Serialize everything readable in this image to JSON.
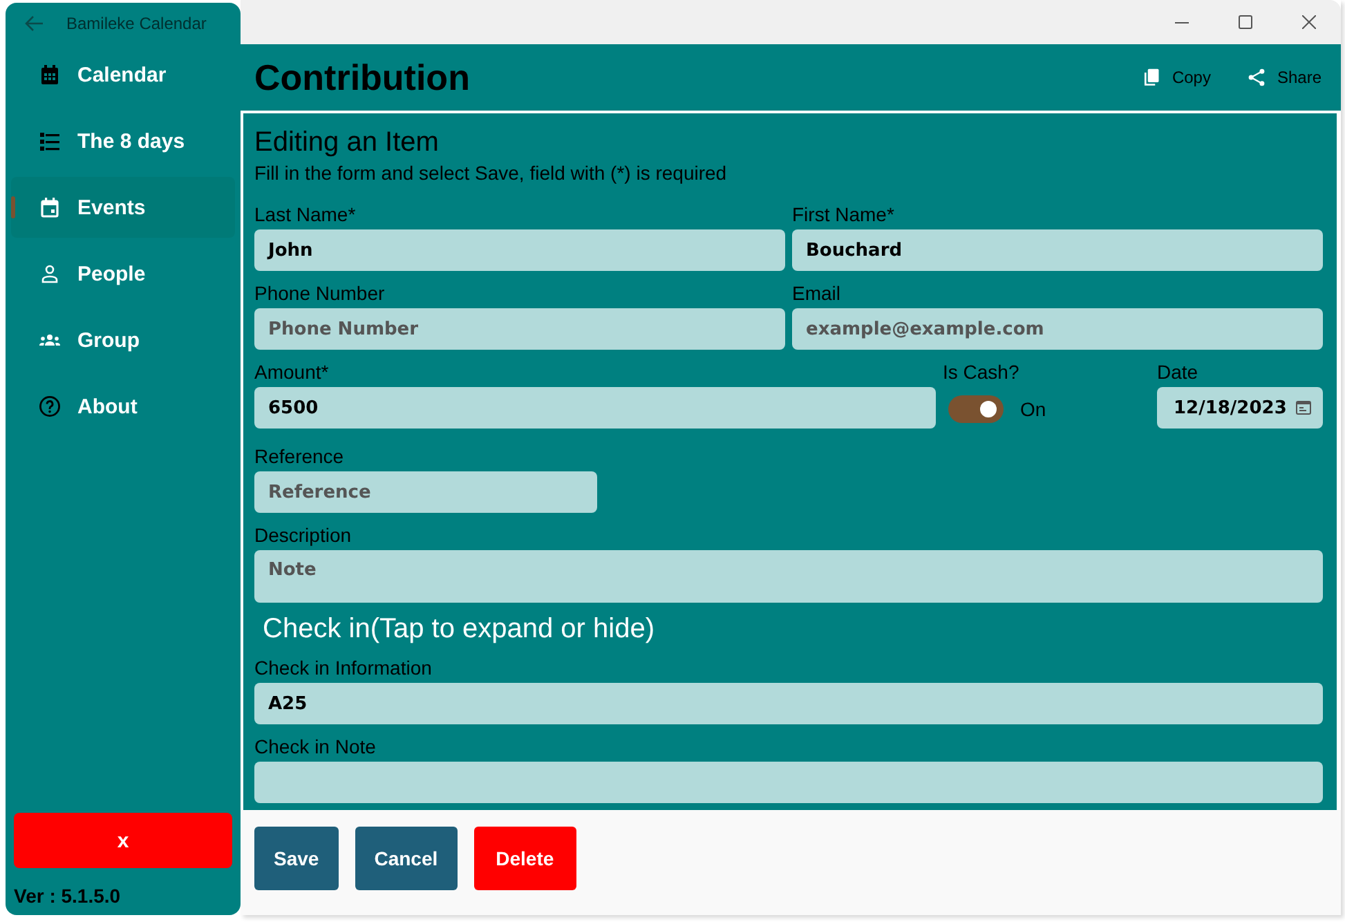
{
  "window": {
    "title": "Bamileke Calendar"
  },
  "sidebar": {
    "items": [
      {
        "label": "Calendar",
        "selected": false
      },
      {
        "label": "The 8 days",
        "selected": false
      },
      {
        "label": "Events",
        "selected": true
      },
      {
        "label": "People",
        "selected": false
      },
      {
        "label": "Group",
        "selected": false
      },
      {
        "label": "About",
        "selected": false
      }
    ],
    "close_button": "x",
    "version": "Ver : 5.1.5.0"
  },
  "header": {
    "title": "Contribution",
    "actions": [
      {
        "label": "Copy"
      },
      {
        "label": "Share"
      }
    ]
  },
  "form": {
    "heading": "Editing an Item",
    "subheading": "Fill in the form and select Save, field with (*) is required",
    "rows": [
      {
        "fields": [
          {
            "kind": "text",
            "label": "Last Name*",
            "value": "John"
          },
          {
            "kind": "text",
            "label": "First Name*",
            "value": "Bouchard"
          }
        ]
      },
      {
        "fields": [
          {
            "kind": "text",
            "label": "Phone Number",
            "placeholder": "Phone Number"
          },
          {
            "kind": "text",
            "label": "Email",
            "placeholder": "example@example.com"
          }
        ]
      },
      {
        "fields": [
          {
            "kind": "text",
            "label": "Amount*",
            "value": "6500"
          },
          {
            "kind": "toggle",
            "label": "Is Cash?",
            "on": true,
            "state_text": "On"
          },
          {
            "kind": "date",
            "label": "Date",
            "value": "12/18/2023"
          }
        ]
      },
      {
        "fields": [
          {
            "kind": "text",
            "label": "Reference",
            "placeholder": "Reference"
          }
        ]
      },
      {
        "fields": [
          {
            "kind": "multiline",
            "label": "Description",
            "placeholder": "Note"
          }
        ]
      }
    ],
    "check_in": {
      "title": "Check in(Tap to expand or hide)",
      "rows": [
        {
          "fields": [
            {
              "kind": "text",
              "label": "Check in Information",
              "value": "A25"
            }
          ]
        },
        {
          "fields": [
            {
              "kind": "text",
              "label": "Check in Note"
            }
          ]
        }
      ]
    }
  },
  "buttons": [
    {
      "label": "Save",
      "kind": "primary"
    },
    {
      "label": "Cancel",
      "kind": "primary"
    },
    {
      "label": "Delete",
      "kind": "danger"
    }
  ]
}
